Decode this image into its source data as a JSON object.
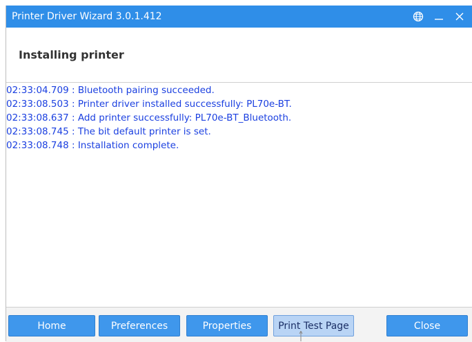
{
  "window": {
    "title": "Printer Driver Wizard  3.0.1.412"
  },
  "header": {
    "title": "Installing printer"
  },
  "log": [
    "02:33:04.709 : Bluetooth pairing succeeded.",
    "02:33:08.503 : Printer driver installed successfully: PL70e-BT.",
    "02:33:08.637 : Add printer successfully: PL70e-BT_Bluetooth.",
    "02:33:08.745 : The bit default printer is set.",
    "02:33:08.748 : Installation complete."
  ],
  "footer": {
    "home_label": "Home",
    "preferences_label": "Preferences",
    "properties_label": "Properties",
    "print_test_label": "Print Test Page",
    "close_label": "Close"
  },
  "icons": {
    "language": "globe-icon",
    "minimize": "minimize-icon",
    "close": "close-icon"
  },
  "colors": {
    "titlebar": "#2f8ee8",
    "log_text": "#1a3fe0",
    "button": "#3f97ec",
    "button_hover": "#b9d4f5"
  }
}
